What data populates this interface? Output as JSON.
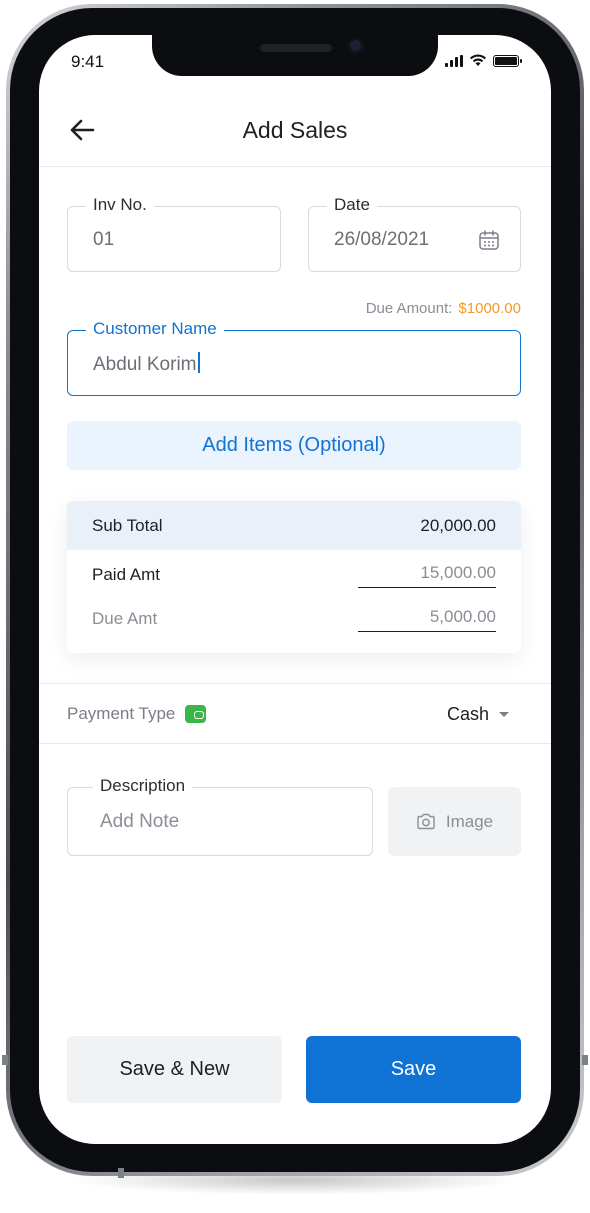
{
  "status_bar": {
    "time": "9:41"
  },
  "header": {
    "title": "Add Sales"
  },
  "form": {
    "invoice": {
      "label": "Inv No.",
      "value": "01"
    },
    "date": {
      "label": "Date",
      "value": "26/08/2021"
    },
    "due": {
      "label": "Due Amount:",
      "amount": "$1000.00"
    },
    "customer": {
      "label": "Customer Name",
      "value": "Abdul Korim"
    },
    "add_items_label": "Add Items (Optional)"
  },
  "summary": {
    "sub_total_label": "Sub Total",
    "sub_total_value": "20,000.00",
    "paid_label": "Paid Amt",
    "paid_value": "15,000.00",
    "due_label": "Due Amt",
    "due_value": "5,000.00"
  },
  "payment": {
    "label": "Payment Type",
    "value": "Cash"
  },
  "description": {
    "label": "Description",
    "placeholder": "Add Note"
  },
  "image_button_label": "Image",
  "actions": {
    "save_new_label": "Save & New",
    "save_label": "Save"
  },
  "colors": {
    "primary": "#0f73d6",
    "accent_orange": "#f39a2b",
    "wallet_green": "#3bb54a",
    "light_blue_bg": "#eaf3fe"
  },
  "icons": [
    "back-arrow-icon",
    "calendar-icon",
    "wallet-icon",
    "chevron-down-icon",
    "camera-icon"
  ]
}
